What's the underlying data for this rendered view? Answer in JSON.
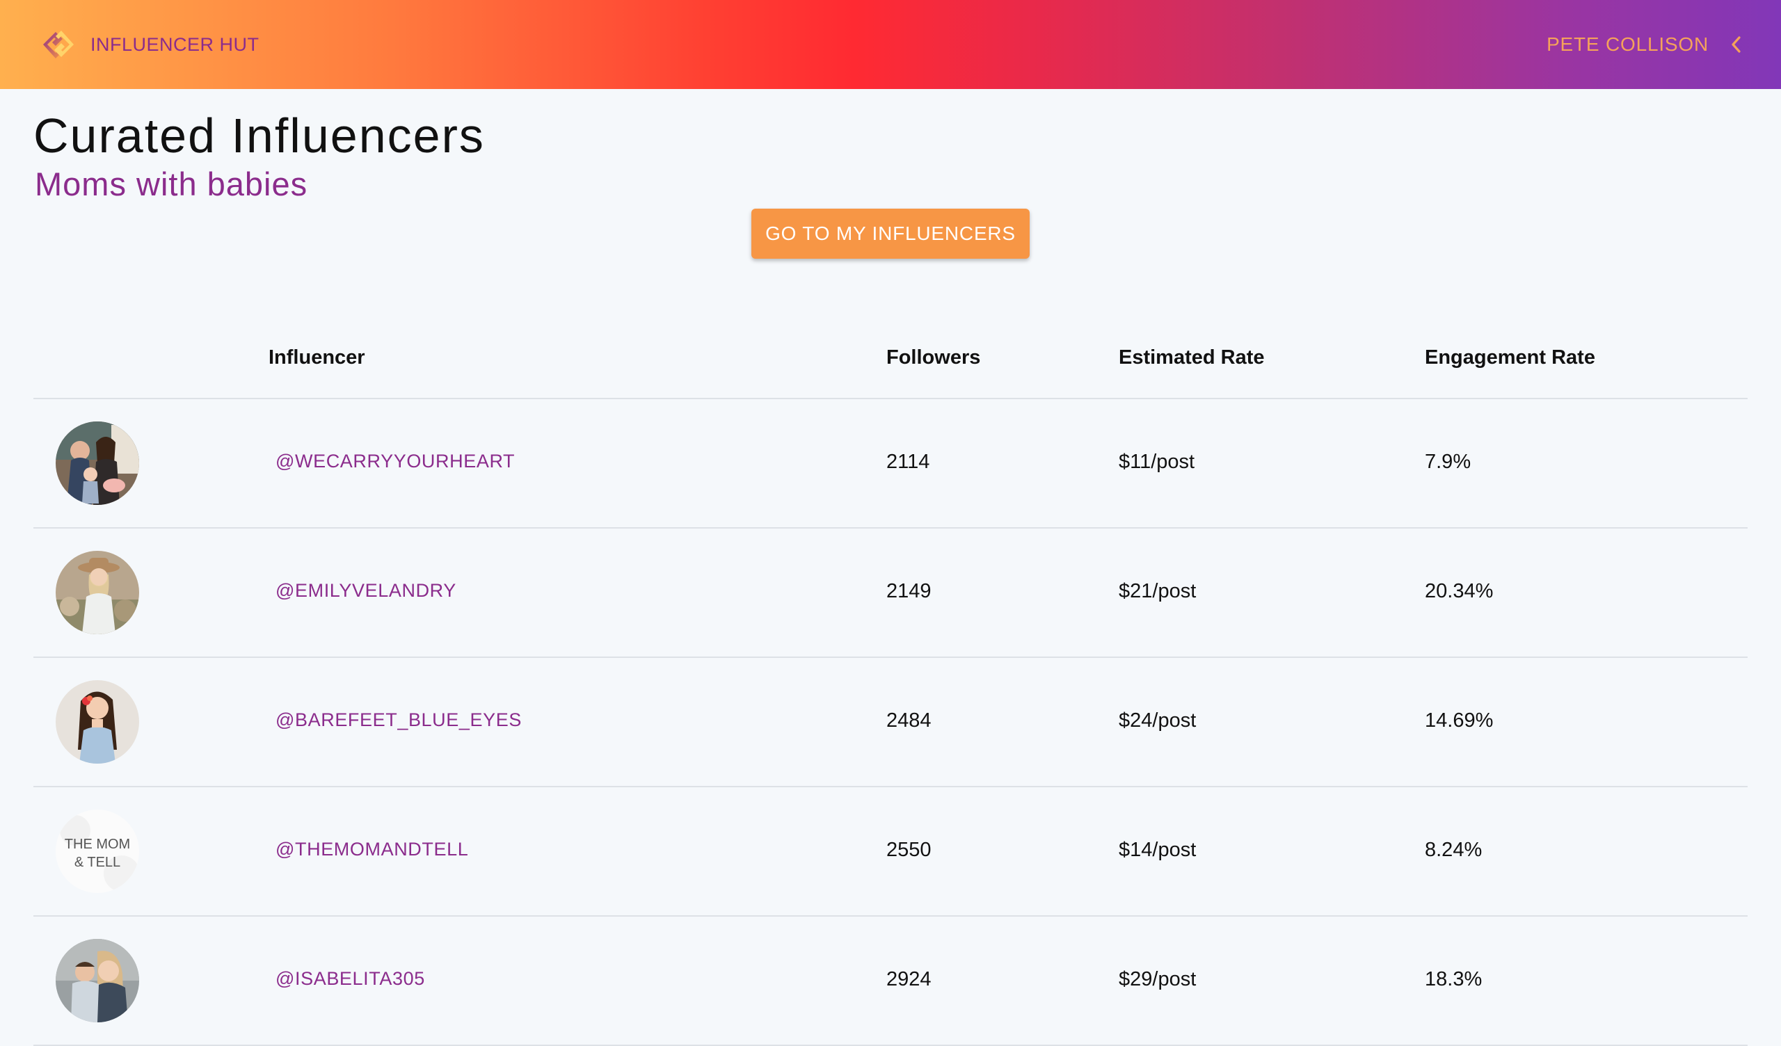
{
  "header": {
    "brand_name": "INFLUENCER HUT",
    "user_name": "PETE COLLISON",
    "gradient_colors": [
      "#ffb04e",
      "#ff2a32",
      "#8237b8"
    ]
  },
  "page": {
    "title": "Curated Influencers",
    "subtitle": "Moms with babies",
    "cta_label": "GO TO MY INFLUENCERS"
  },
  "table": {
    "headers": [
      "Influencer",
      "Followers",
      "Estimated Rate",
      "Engagement Rate"
    ],
    "rows": [
      {
        "handle": "@WECARRYYOURHEART",
        "followers": "2114",
        "rate": "$11/post",
        "engagement": "7.9%",
        "avatar": "family-photo"
      },
      {
        "handle": "@EMILYVELANDRY",
        "followers": "2149",
        "rate": "$21/post",
        "engagement": "20.34%",
        "avatar": "woman-hat-photo"
      },
      {
        "handle": "@BAREFEET_BLUE_EYES",
        "followers": "2484",
        "rate": "$24/post",
        "engagement": "14.69%",
        "avatar": "woman-flower-photo"
      },
      {
        "handle": "@THEMOMANDTELL",
        "followers": "2550",
        "rate": "$14/post",
        "engagement": "8.24%",
        "avatar": "text-logo",
        "avatar_text": [
          "THE MOM",
          "& TELL"
        ]
      },
      {
        "handle": "@ISABELITA305",
        "followers": "2924",
        "rate": "$29/post",
        "engagement": "18.3%",
        "avatar": "mother-baby-photo"
      }
    ]
  },
  "colors": {
    "accent_purple": "#8b2c8c",
    "cta_orange": "#f79645",
    "page_background": "#f5f8fb"
  }
}
